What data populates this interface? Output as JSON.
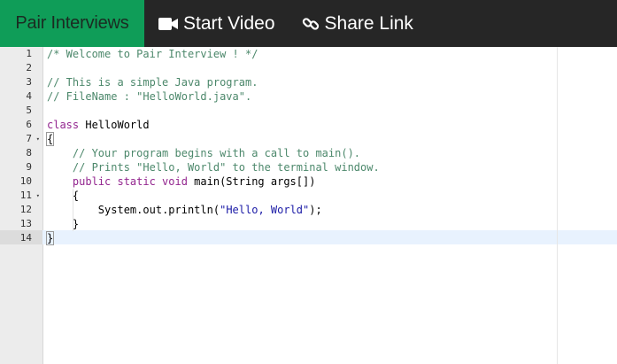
{
  "header": {
    "brand": "Pair Interviews",
    "start_video": "Start Video",
    "share_link": "Share Link",
    "icons": {
      "video": "video-camera-icon",
      "link": "link-icon"
    },
    "colors": {
      "bar": "#262626",
      "brand_bg": "#0f9d58",
      "text": "#ffffff"
    }
  },
  "editor": {
    "active_line": 14,
    "fold_lines": [
      7,
      11
    ],
    "line_numbers": [
      "1",
      "2",
      "3",
      "4",
      "5",
      "6",
      "7",
      "8",
      "9",
      "10",
      "11",
      "12",
      "13",
      "14"
    ],
    "lines": [
      [
        {
          "t": "/* Welcome to Pair Interview ! */",
          "c": "c-comment"
        }
      ],
      [],
      [
        {
          "t": "// This is a simple Java program.",
          "c": "c-comment"
        }
      ],
      [
        {
          "t": "// FileName : \"HelloWorld.java\".",
          "c": "c-comment"
        }
      ],
      [],
      [
        {
          "t": "class",
          "c": "c-kw"
        },
        {
          "t": " HelloWorld",
          "c": ""
        }
      ],
      [
        {
          "t": "{",
          "c": "bracket-match"
        }
      ],
      [
        {
          "t": "    ",
          "c": ""
        },
        {
          "t": "// Your program begins with a call to main().",
          "c": "c-comment"
        }
      ],
      [
        {
          "t": "    ",
          "c": ""
        },
        {
          "t": "// Prints \"Hello, World\" to the terminal window.",
          "c": "c-comment"
        }
      ],
      [
        {
          "t": "    ",
          "c": ""
        },
        {
          "t": "public static void",
          "c": "c-kw"
        },
        {
          "t": " main(String args[])",
          "c": ""
        }
      ],
      [
        {
          "t": "    {",
          "c": ""
        }
      ],
      [
        {
          "t": "        System.",
          "c": ""
        },
        {
          "t": "out",
          "c": ""
        },
        {
          "t": ".println(",
          "c": ""
        },
        {
          "t": "\"Hello, World\"",
          "c": "c-str"
        },
        {
          "t": ");",
          "c": ""
        }
      ],
      [
        {
          "t": "    }",
          "c": ""
        }
      ],
      [
        {
          "t": "}",
          "c": "bracket-match"
        }
      ]
    ]
  }
}
